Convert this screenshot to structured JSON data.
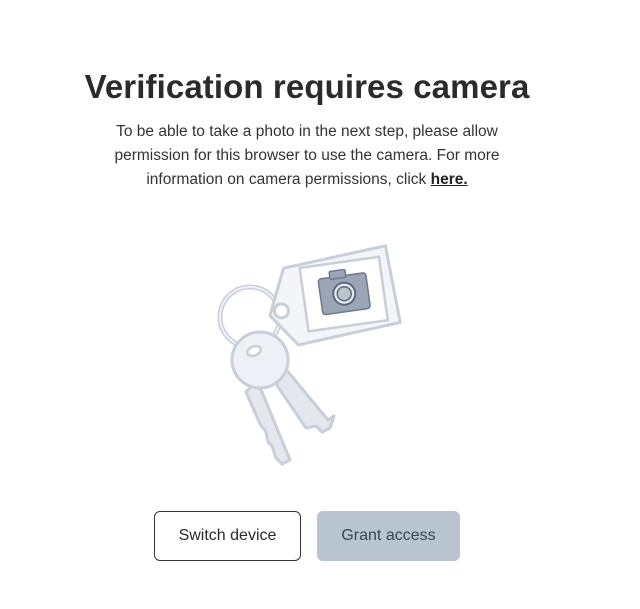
{
  "heading": {
    "title": "Verification requires camera"
  },
  "description": {
    "text": "To be able to take a photo in the next step, please allow permission for this browser to use the camera. For more information on camera permissions, click ",
    "link_label": "here."
  },
  "illustration": {
    "icon": "keys-with-camera-tag-icon",
    "tag_icon": "camera-icon"
  },
  "actions": {
    "switch_label": "Switch device",
    "grant_label": "Grant access"
  },
  "colors": {
    "grant_button_bg": "#b9c4d1",
    "outline_button_border": "#333333",
    "illustration_stroke": "#c9cfd8",
    "illustration_fill": "#eef1f5"
  }
}
